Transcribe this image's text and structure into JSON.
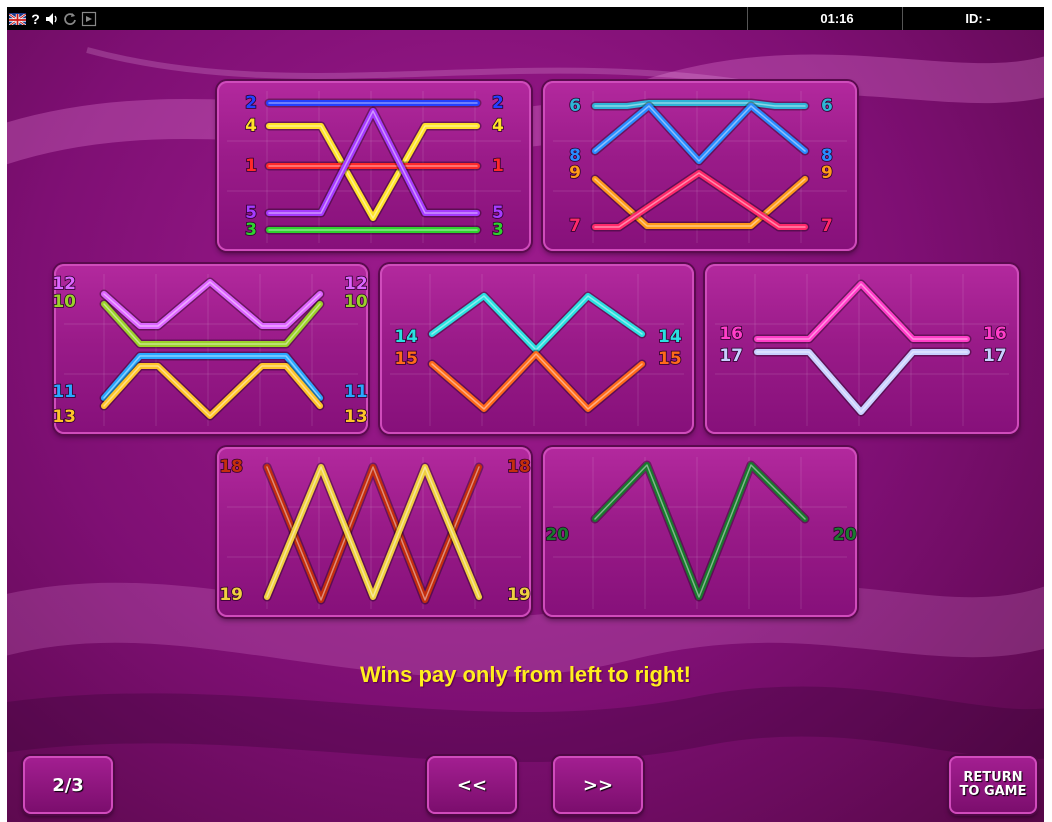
{
  "status_bar": {
    "clock": "01:16",
    "session_id": "ID: -",
    "icons": [
      "uk-flag-icon",
      "help-icon",
      "speaker-icon",
      "reload-icon",
      "window-icon"
    ]
  },
  "paylines": [
    {
      "number": 1,
      "color": "#ff2a2a"
    },
    {
      "number": 2,
      "color": "#2440ff"
    },
    {
      "number": 3,
      "color": "#2fd12f"
    },
    {
      "number": 4,
      "color": "#ffe22a"
    },
    {
      "number": 5,
      "color": "#a63cff"
    },
    {
      "number": 6,
      "color": "#2fb4d6"
    },
    {
      "number": 7,
      "color": "#ff2a6a"
    },
    {
      "number": 8,
      "color": "#2a8cff"
    },
    {
      "number": 9,
      "color": "#ff9a1a"
    },
    {
      "number": 10,
      "color": "#9bd12a"
    },
    {
      "number": 11,
      "color": "#2aa8ff"
    },
    {
      "number": 12,
      "color": "#dd66ff"
    },
    {
      "number": 13,
      "color": "#ffc42a"
    },
    {
      "number": 14,
      "color": "#2ae0e0"
    },
    {
      "number": 15,
      "color": "#ff6a1a"
    },
    {
      "number": 16,
      "color": "#ff3ec8"
    },
    {
      "number": 17,
      "color": "#c8d0ff"
    },
    {
      "number": 18,
      "color": "#c42e0e"
    },
    {
      "number": 19,
      "color": "#f0d040"
    },
    {
      "number": 20,
      "color": "#1a7a2e"
    }
  ],
  "panels": [
    {
      "lines": [
        2,
        4,
        1,
        5,
        3
      ]
    },
    {
      "lines": [
        6,
        8,
        9,
        7
      ]
    },
    {
      "lines": [
        12,
        10,
        11,
        13
      ]
    },
    {
      "lines": [
        14,
        15
      ]
    },
    {
      "lines": [
        16,
        17
      ]
    },
    {
      "lines": [
        18,
        19
      ]
    },
    {
      "lines": [
        20
      ]
    }
  ],
  "wins_note": "Wins pay only from left to right!",
  "page_indicator": "2/3",
  "prev_label": "<<",
  "next_label": ">>",
  "return_label_line1": "RETURN",
  "return_label_line2": "TO GAME"
}
